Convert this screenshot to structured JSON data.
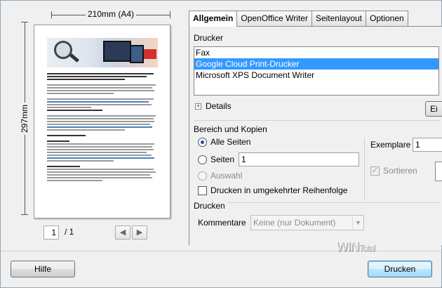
{
  "preview": {
    "width_label": "210mm (A4)",
    "height_label": "297mm",
    "page_current": "1",
    "page_total": "/ 1"
  },
  "tabs": [
    {
      "label": "Allgemein",
      "active": true
    },
    {
      "label": "OpenOffice Writer",
      "active": false
    },
    {
      "label": "Seitenlayout",
      "active": false
    },
    {
      "label": "Optionen",
      "active": false
    }
  ],
  "printer": {
    "section_label": "Drucker",
    "items": [
      {
        "label": "Fax",
        "selected": false
      },
      {
        "label": "Google Cloud Print-Drucker",
        "selected": true
      },
      {
        "label": "Microsoft XPS Document Writer",
        "selected": false
      }
    ],
    "details_label": "Details",
    "properties_label": "Ei"
  },
  "range": {
    "section_label": "Bereich und Kopien",
    "all_pages_label": "Alle Seiten",
    "pages_label": "Seiten",
    "pages_value": "1",
    "selection_label": "Auswahl",
    "reverse_label": "Drucken in umgekehrter Reihenfolge",
    "copies_label": "Exemplare",
    "copies_value": "1",
    "collate_label": "Sortieren"
  },
  "print_section": {
    "section_label": "Drucken",
    "comments_label": "Kommentare",
    "comments_value": "Keine (nur Dokument)"
  },
  "buttons": {
    "help_label": "Hilfe",
    "print_label": "Drucken"
  },
  "watermark": {
    "main": "WIN",
    "sub": "Total"
  }
}
